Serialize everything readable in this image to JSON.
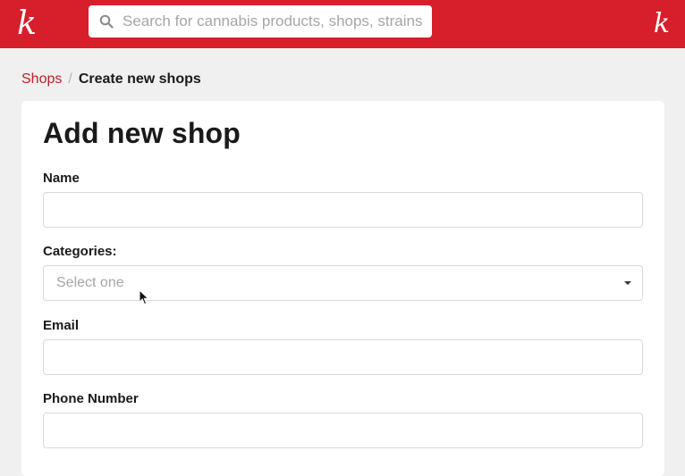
{
  "header": {
    "logo_left": "k",
    "logo_right": "k",
    "search": {
      "placeholder": "Search for cannabis products, shops, strains"
    },
    "brand_color": "#d61f2b"
  },
  "breadcrumb": {
    "parent": "Shops",
    "separator": "/",
    "current": "Create new shops"
  },
  "form": {
    "title": "Add new shop",
    "fields": [
      {
        "label": "Name",
        "value": ""
      },
      {
        "label": "Categories:",
        "placeholder": "Select one"
      },
      {
        "label": "Email",
        "value": ""
      },
      {
        "label": "Phone Number",
        "value": ""
      }
    ]
  },
  "icons": {
    "search": "search-icon",
    "dropdown": "chevron-down-icon",
    "cursor": "mouse-cursor-icon"
  }
}
